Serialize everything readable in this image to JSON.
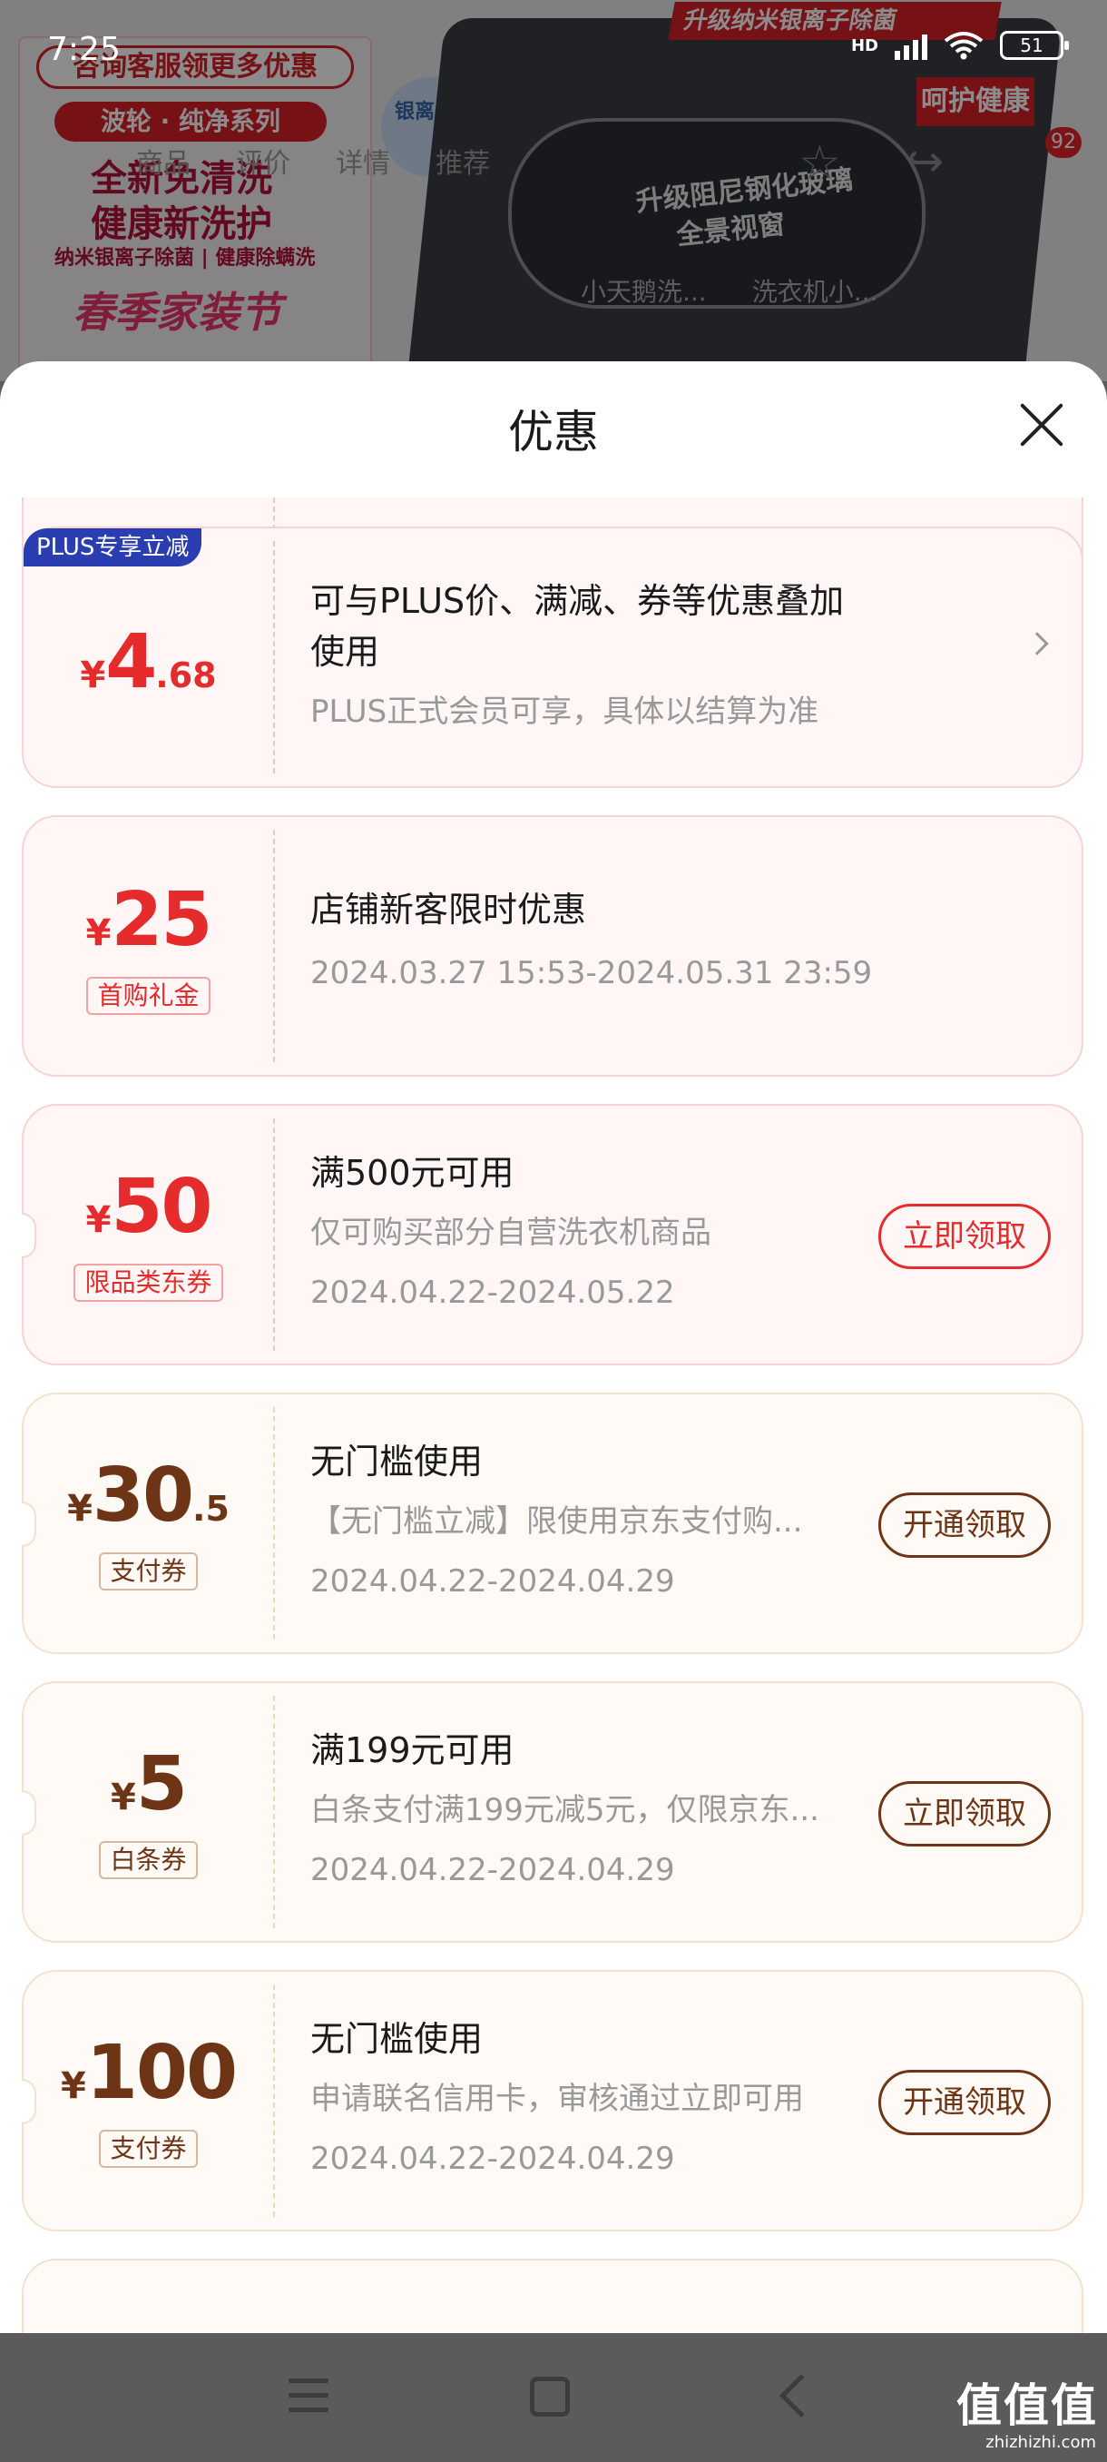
{
  "status_bar": {
    "time": "7:25",
    "network": "HD",
    "battery": "51"
  },
  "background": {
    "consult": "咨询客服领更多优惠",
    "series": "波轮 · 纯净系列",
    "slogan1": "全新免清洗",
    "slogan2": "健康新洗护",
    "tagline": "纳米银离子除菌 | 健康除螨洗",
    "festival": "春季家装节",
    "silver_badge": "银离子除菌",
    "top_banner": "升级纳米银离子除菌",
    "health": "呵护健康",
    "glass_line1": "升级阻尼钢化玻璃",
    "glass_line2": "全景视窗",
    "tabs": [
      "商品",
      "评价",
      "详情",
      "推荐"
    ],
    "cart_count": "92",
    "rec1": "小天鹅洗...",
    "rec2": "洗衣机小..."
  },
  "sheet": {
    "title": "优惠"
  },
  "coupons": [
    {
      "style": "red",
      "badge": "PLUS专享立减",
      "currency": "¥",
      "amount_int": "4",
      "amount_dec": ".68",
      "line1": "可与PLUS价、满减、券等优惠叠加",
      "line1b": "使用",
      "line2": "PLUS正式会员可享，具体以结算为准"
    },
    {
      "style": "red",
      "currency": "¥",
      "amount_int": "25",
      "tag": "首购礼金",
      "line1": "店铺新客限时优惠",
      "line2": "2024.03.27 15:53-2024.05.31 23:59"
    },
    {
      "style": "red",
      "currency": "¥",
      "amount_int": "50",
      "tag": "限品类东券",
      "line1": "满500元可用",
      "line2": "仅可购买部分自营洗衣机商品",
      "line3": "2024.04.22-2024.05.22",
      "action": "立即领取"
    },
    {
      "style": "brown",
      "currency": "¥",
      "amount_int": "30",
      "amount_dec": ".5",
      "tag": "支付券",
      "line1": "无门槛使用",
      "line2": "【无门槛立减】限使用京东支付购...",
      "line3": "2024.04.22-2024.04.29",
      "action": "开通领取"
    },
    {
      "style": "brown",
      "currency": "¥",
      "amount_int": "5",
      "tag": "白条券",
      "line1": "满199元可用",
      "line2": "白条支付满199元减5元，仅限京东...",
      "line3": "2024.04.22-2024.04.29",
      "action": "立即领取"
    },
    {
      "style": "brown",
      "currency": "¥",
      "amount_int": "100",
      "tag": "支付券",
      "line1": "无门槛使用",
      "line2": "申请联名信用卡，审核通过立即可用",
      "line3": "2024.04.22-2024.04.29",
      "action": "开通领取"
    }
  ],
  "watermark": {
    "main": "值值值",
    "sub": "zhizhizhi.com"
  }
}
